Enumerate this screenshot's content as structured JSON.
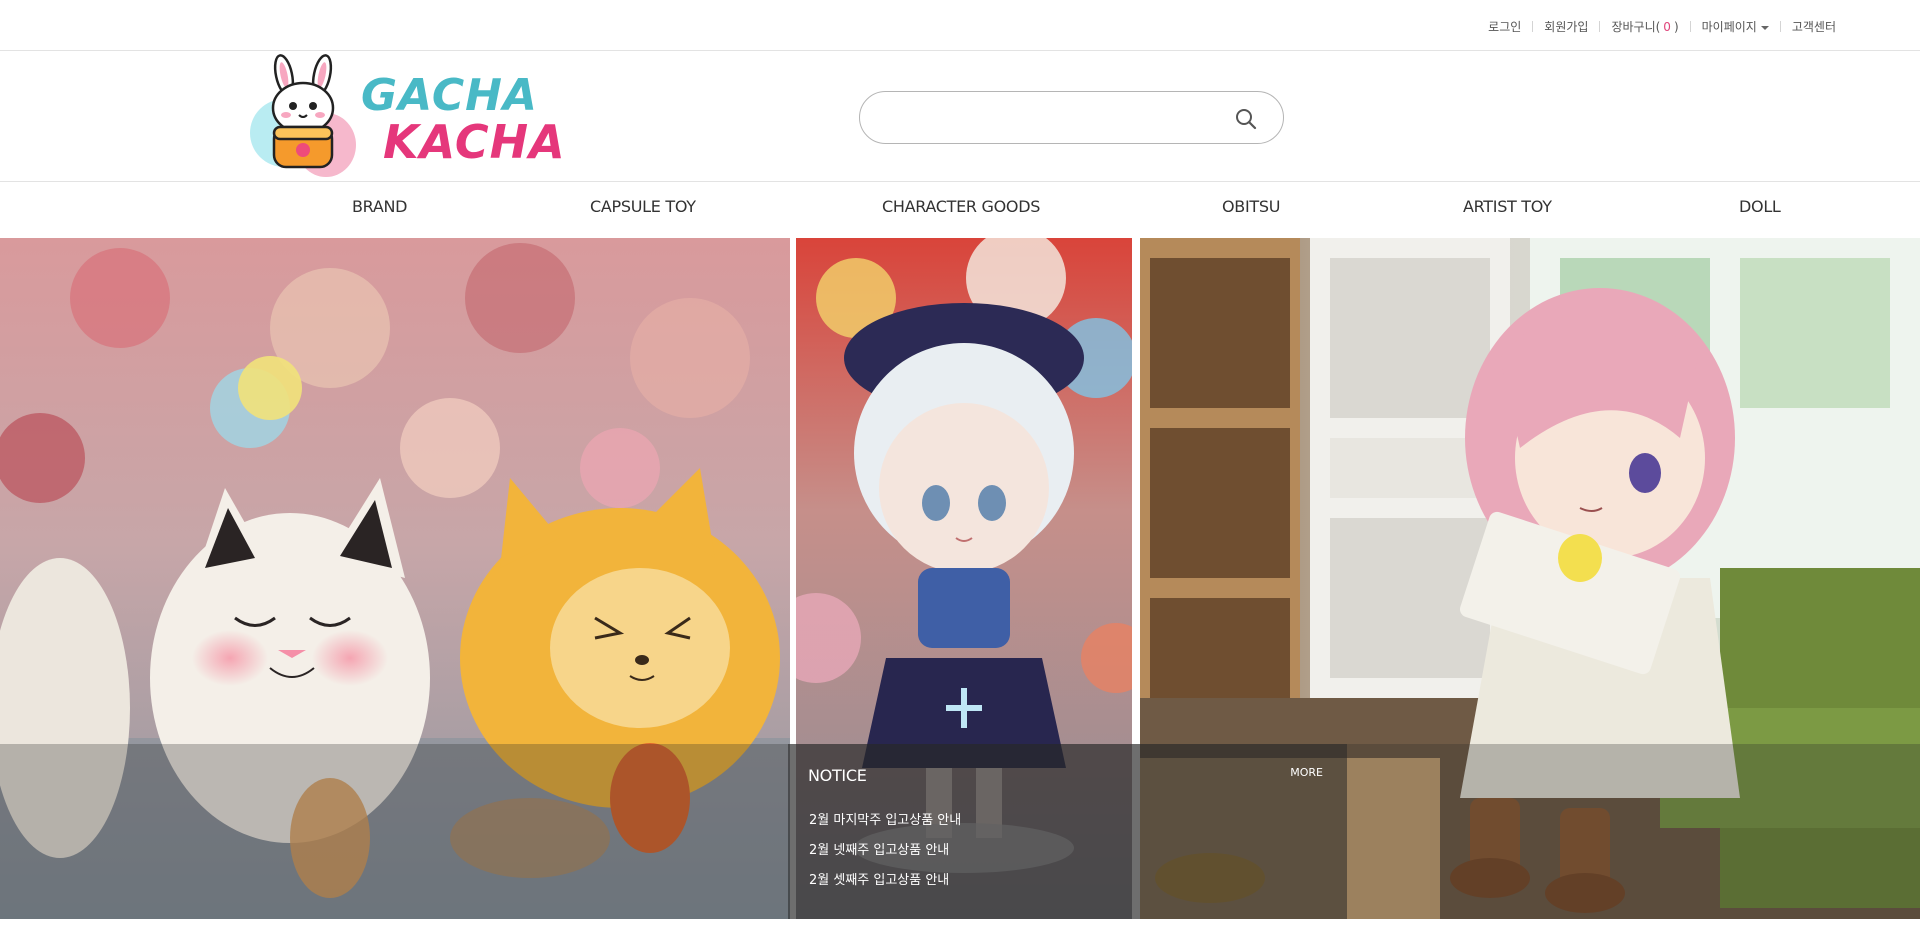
{
  "topbar": {
    "links": [
      "로그인",
      "회원가입"
    ],
    "cart_label": "장바구니(",
    "cart_count": "0",
    "cart_close": ")",
    "mypage": "마이페이지",
    "support": "고객센터"
  },
  "logo": {
    "line1": "GACHA",
    "line2": "KACHA"
  },
  "search": {
    "value": "",
    "placeholder": "",
    "icon": "search-icon"
  },
  "nav": {
    "items": [
      "BRAND",
      "CAPSULE TOY",
      "CHARACTER GOODS",
      "OBITSU",
      "ARTIST TOY",
      "DOLL"
    ]
  },
  "notice": {
    "title": "NOTICE",
    "more": "MORE",
    "items": [
      "2월 마지막주 입고상품 안내",
      "2월 넷째주 입고상품 안내",
      "2월 셋째주 입고상품 안내"
    ]
  },
  "colors": {
    "brand_teal": "#49b9c6",
    "brand_pink": "#e5377b",
    "cart_count": "#e0457b"
  }
}
